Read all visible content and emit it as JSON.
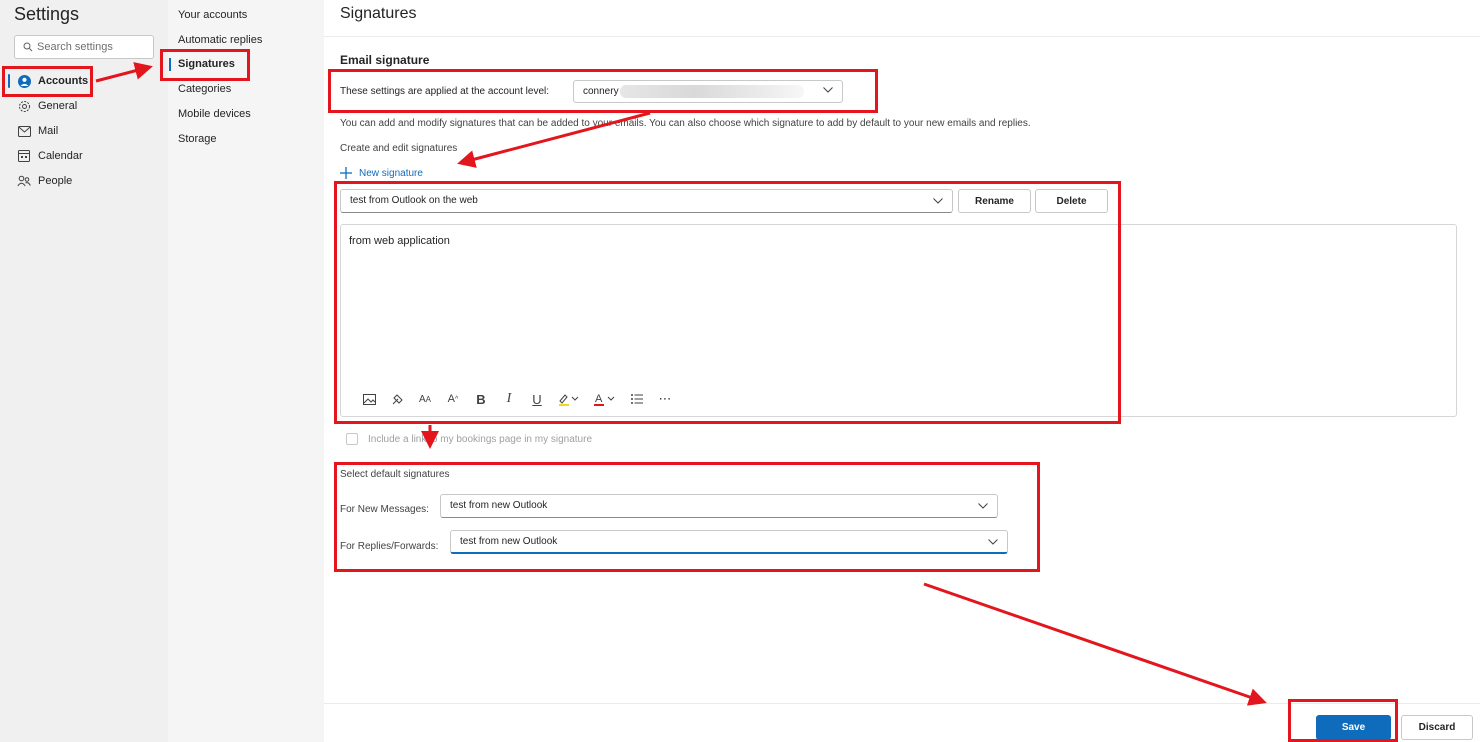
{
  "left_nav": {
    "title": "Settings",
    "search_placeholder": "Search settings",
    "items": [
      {
        "label": "Accounts",
        "icon": "person-icon",
        "active": true
      },
      {
        "label": "General",
        "icon": "gear-icon"
      },
      {
        "label": "Mail",
        "icon": "mail-icon"
      },
      {
        "label": "Calendar",
        "icon": "calendar-icon"
      },
      {
        "label": "People",
        "icon": "people-icon"
      }
    ]
  },
  "sub_nav": {
    "items": [
      {
        "label": "Your accounts"
      },
      {
        "label": "Automatic replies"
      },
      {
        "label": "Signatures",
        "active": true
      },
      {
        "label": "Categories"
      },
      {
        "label": "Mobile devices"
      },
      {
        "label": "Storage"
      }
    ]
  },
  "main": {
    "page_title": "Signatures",
    "section_title": "Email signature",
    "account_level_label": "These settings are applied at the account level:",
    "account_value": "connery",
    "description": "You can add and modify signatures that can be added to your emails. You can also choose which signature to add by default to your new emails and replies.",
    "create_edit_label": "Create and edit signatures",
    "new_signature_label": "New signature",
    "signature_selected": "test from Outlook on the web",
    "rename_label": "Rename",
    "delete_label": "Delete",
    "editor_content": "from web application",
    "bookings_label": "Include a link to my bookings page in my signature",
    "default_section_title": "Select default signatures",
    "new_messages_label": "For New Messages:",
    "new_messages_value": "test from new Outlook",
    "replies_label": "For Replies/Forwards:",
    "replies_value": "test from new Outlook",
    "save_label": "Save",
    "discard_label": "Discard"
  },
  "colors": {
    "accent": "#0f6cbd",
    "annotation": "#e3151d"
  }
}
